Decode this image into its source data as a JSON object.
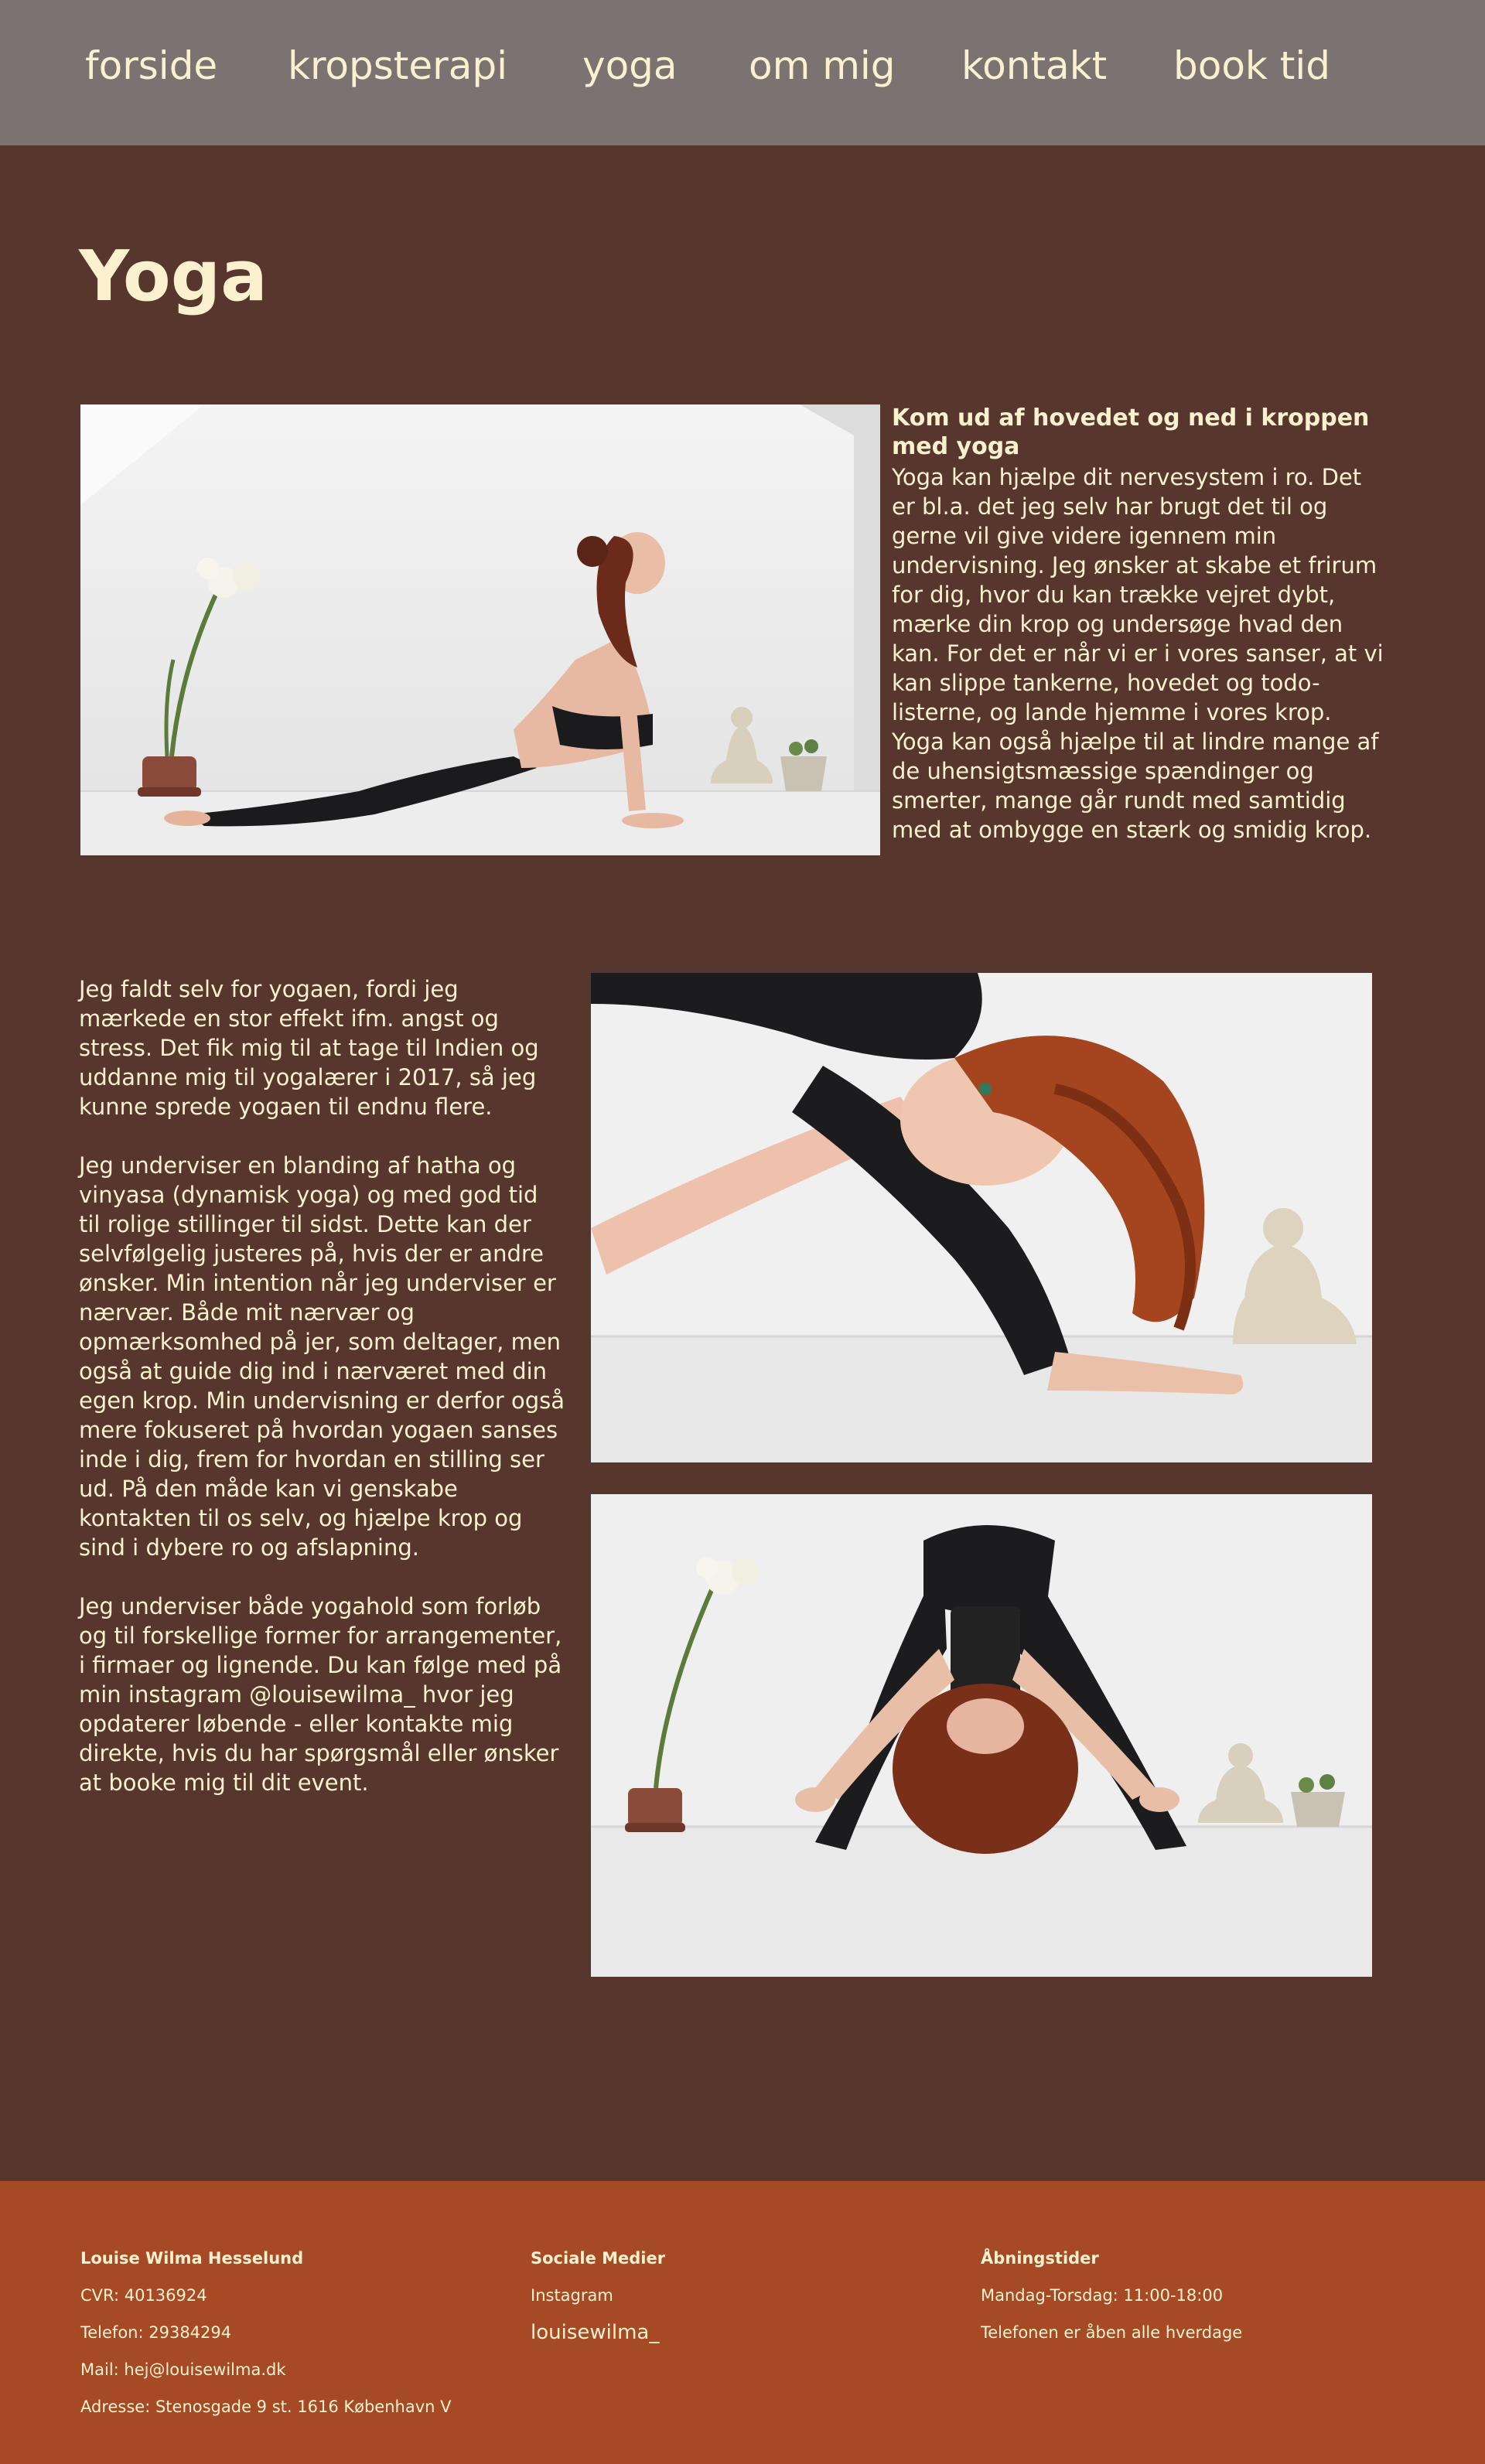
{
  "nav": {
    "items": [
      "forside",
      "kropsterapi",
      "yoga",
      "om mig",
      "kontakt",
      "book tid"
    ]
  },
  "page": {
    "title": "Yoga"
  },
  "intro": {
    "heading": "Kom ud af hovedet og ned i kroppen med yoga",
    "body": "Yoga kan hjælpe dit nervesystem i ro. Det er bl.a. det jeg selv har brugt det til og gerne vil give videre igennem min undervisning. Jeg ønsker at skabe et frirum for dig, hvor du kan trække vejret dybt, mærke din krop og undersøge hvad den kan. For det er når vi er i vores sanser, at vi kan slippe tankerne, hovedet og todo-listerne, og lande hjemme i vores krop. Yoga kan også hjælpe til at lindre mange af de uhensigtsmæssige spændinger og smerter, mange går rundt med samtidig med at ombygge en stærk og smidig krop."
  },
  "story": {
    "paragraphs": [
      "Jeg faldt selv for yogaen, fordi jeg mærkede en stor effekt ifm. angst og stress. Det fik mig til at tage til Indien og uddanne mig til yogalærer i 2017, så jeg kunne sprede yogaen til endnu flere.",
      "Jeg underviser en blanding af hatha og vinyasa (dynamisk yoga) og med god tid til rolige stillinger til sidst. Dette kan der selvfølgelig justeres på, hvis der er andre ønsker. Min intention når jeg underviser er nærvær. Både mit nærvær og opmærksomhed på jer, som deltager, men også at guide dig ind i nærværet med din egen krop. Min undervisning er derfor også mere fokuseret på hvordan yogaen sanses inde i dig, frem for hvordan en stilling ser ud. På den måde kan vi genskabe kontakten til os selv, og hjælpe krop og sind i dybere ro og afslapning.",
      "Jeg underviser både yogahold som forløb og til forskellige former for arrangementer, i firmaer og lignende. Du kan følge med på min instagram @louisewilma_ hvor jeg opdaterer løbende - eller kontakte mig direkte, hvis du har spørgsmål eller ønsker at booke mig til dit event."
    ]
  },
  "footer": {
    "company": {
      "name": "Louise Wilma Hesselund",
      "cvr": "CVR: 40136924",
      "phone": "Telefon: 29384294",
      "mail": "Mail: hej@louisewilma.dk",
      "address": "Adresse: Stenosgade 9 st. 1616 København V"
    },
    "social": {
      "heading": "Sociale Medier",
      "platform": "Instagram",
      "handle": "louisewilma_"
    },
    "hours": {
      "heading": "Åbningstider",
      "weekdays": "Mandag-Torsdag: 11:00-18:00",
      "phone_note": "Telefonen er åben alle hverdage"
    }
  },
  "colors": {
    "page_bg": "#57362d",
    "nav_bg": "#7a7372",
    "footer_bg": "#a54a25",
    "text": "#fcf1cf"
  }
}
